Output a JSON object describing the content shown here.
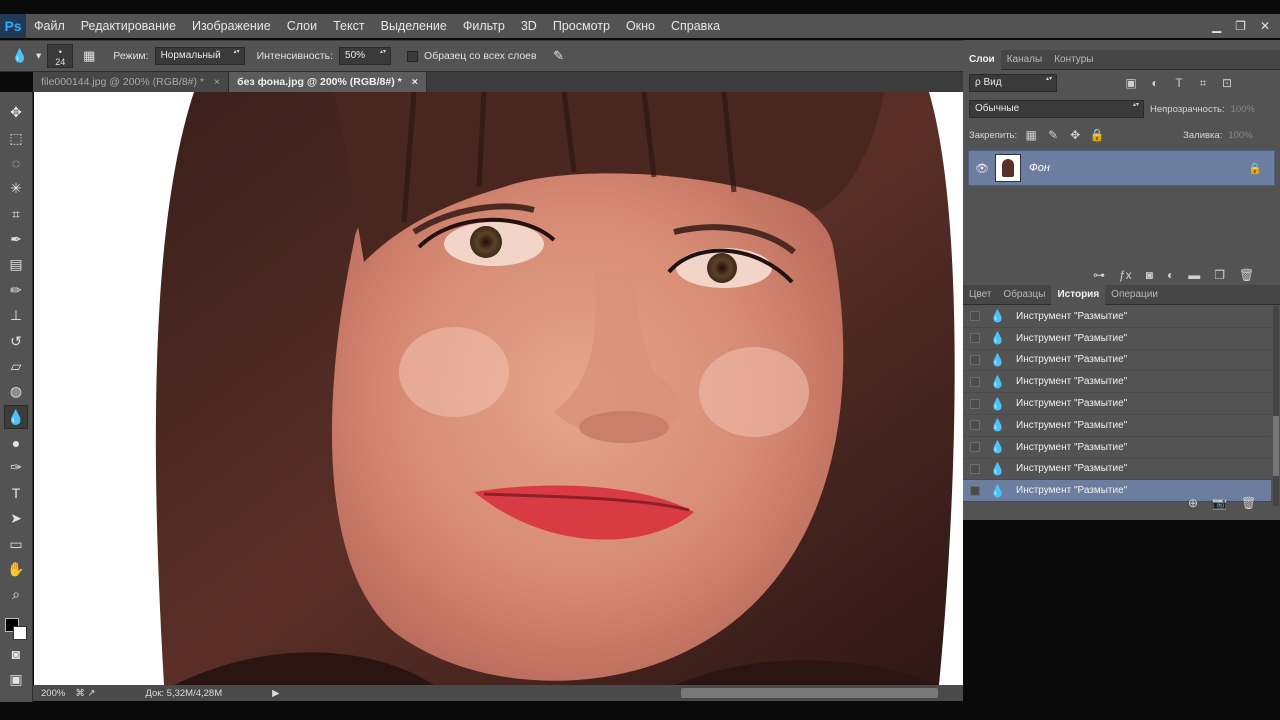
{
  "app": {
    "logo": "Ps"
  },
  "menu": [
    "Файл",
    "Редактирование",
    "Изображение",
    "Слои",
    "Текст",
    "Выделение",
    "Фильтр",
    "3D",
    "Просмотр",
    "Окно",
    "Справка"
  ],
  "window_controls": {
    "minimize": "▁",
    "restore": "❐",
    "close": "✕"
  },
  "options": {
    "brush_size": "24",
    "mode_label": "Режим:",
    "mode_value": "Нормальный",
    "intensity_label": "Интенсивность:",
    "intensity_value": "50%",
    "sample_all_label": "Образец со всех слоев"
  },
  "tabs": [
    {
      "label": "file000144.jpg @ 200% (RGB/8#) *",
      "close": "×"
    },
    {
      "label": "без фона.jpg @ 200% (RGB/8#) *",
      "close": "×"
    }
  ],
  "status": {
    "zoom": "200%",
    "doc": "Док: 5,32M/4,28M"
  },
  "layers_panel": {
    "tabs": [
      "Слои",
      "Каналы",
      "Контуры"
    ],
    "filter_value": "ρ Вид",
    "blend_value": "Обычные",
    "opacity_label": "Непрозрачность:",
    "opacity_value": "100%",
    "lock_label": "Закрепить:",
    "fill_label": "Заливка:",
    "fill_value": "100%",
    "layer_name": "Фон"
  },
  "history_panel": {
    "tabs": [
      "Цвет",
      "Образцы",
      "История",
      "Операции"
    ],
    "items": [
      "Инструмент \"Размытие\"",
      "Инструмент \"Размытие\"",
      "Инструмент \"Размытие\"",
      "Инструмент \"Размытие\"",
      "Инструмент \"Размытие\"",
      "Инструмент \"Размытие\"",
      "Инструмент \"Размытие\"",
      "Инструмент \"Размытие\"",
      "Инструмент \"Размытие\""
    ]
  },
  "colors": {
    "selection_blue": "#6b7ea0",
    "panel_gray": "#535353",
    "dark_gray": "#3c3c3c"
  }
}
